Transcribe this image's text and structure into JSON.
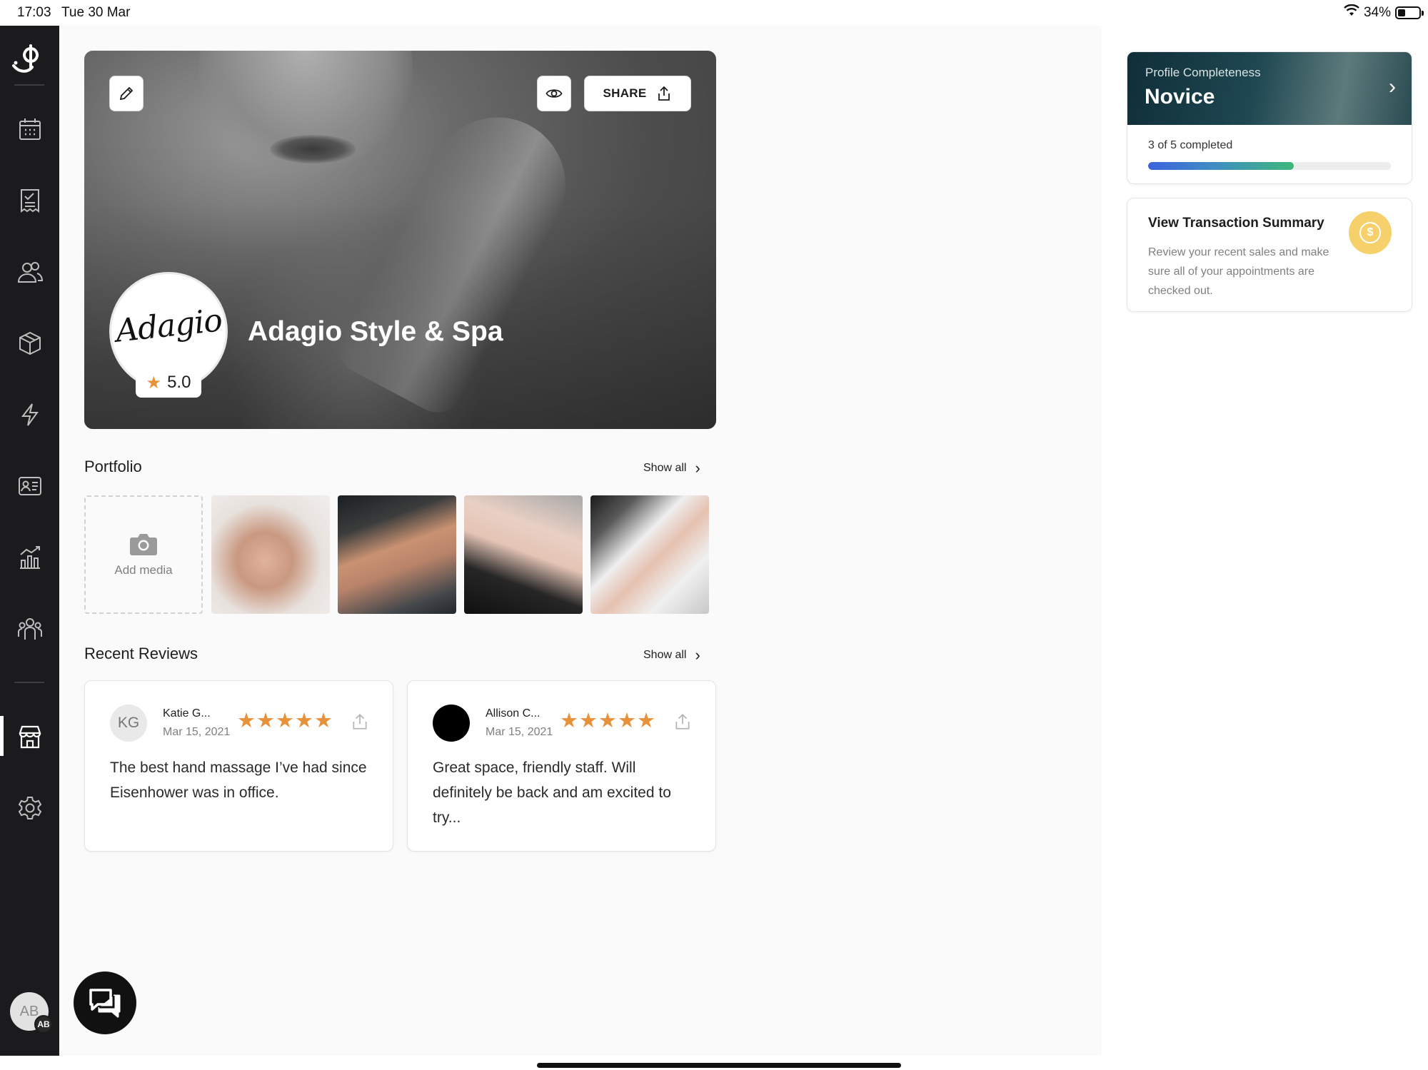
{
  "status_bar": {
    "time": "17:03",
    "date": "Tue 30 Mar",
    "battery": "34%",
    "battery_level": 0.34
  },
  "sidebar": {
    "items": [
      {
        "icon": "calendar-icon"
      },
      {
        "icon": "receipt-icon"
      },
      {
        "icon": "clients-icon"
      },
      {
        "icon": "box-icon"
      },
      {
        "icon": "lightning-icon"
      },
      {
        "icon": "id-card-icon"
      },
      {
        "icon": "chart-icon"
      },
      {
        "icon": "team-icon"
      },
      {
        "icon": "storefront-icon",
        "active": true
      },
      {
        "icon": "gear-icon"
      }
    ],
    "avatar_initials": "AB",
    "avatar_badge": "AB"
  },
  "hero": {
    "business_name": "Adagio Style & Spa",
    "logo_text": "Adagio",
    "rating": "5.0",
    "share_label": "SHARE"
  },
  "portfolio": {
    "title": "Portfolio",
    "show_all": "Show all",
    "add_media_label": "Add media",
    "photos": [
      "hand-massage-photo",
      "chest-massage-photo",
      "facial-treatment-photo",
      "manicure-photo"
    ]
  },
  "reviews": {
    "title": "Recent Reviews",
    "show_all": "Show all",
    "items": [
      {
        "initials": "KG",
        "name": "Katie G...",
        "date": "Mar 15, 2021",
        "stars": "★★★★★",
        "rating": 5,
        "text": "The best hand massage I’ve had since Eisenhower was in office."
      },
      {
        "initials": "",
        "name": "Allison C...",
        "date": "Mar 15, 2021",
        "stars": "★★★★★",
        "rating": 5,
        "text": "Great space, friendly staff. Will definitely be back and am excited to try..."
      }
    ]
  },
  "profile_completeness": {
    "label": "Profile Completeness",
    "level": "Novice",
    "progress_text": "3 of 5 completed",
    "completed": 3,
    "total": 5,
    "progress_fraction": 0.6
  },
  "transaction_summary": {
    "title": "View Transaction Summary",
    "description": "Review your recent sales and make sure all of your appointments are checked out.",
    "icon_symbol": "$"
  },
  "colors": {
    "star": "#e8913b",
    "sidebar_bg": "#1b1b1d",
    "progress_start": "#3e63dd",
    "progress_end": "#3fb87b",
    "coin": "#f6d06a"
  }
}
